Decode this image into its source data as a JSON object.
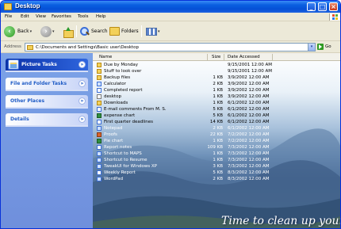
{
  "window": {
    "title": "Desktop"
  },
  "menu": [
    "File",
    "Edit",
    "View",
    "Favorites",
    "Tools",
    "Help"
  ],
  "toolbar": {
    "back_label": "Back",
    "search_label": "Search",
    "folders_label": "Folders"
  },
  "address": {
    "label": "Address",
    "value": "C:\\Documents and Settings\\Basic user\\Desktop",
    "go_label": "Go"
  },
  "task_panels": [
    {
      "title": "Picture Tasks"
    },
    {
      "title": "File and Folder Tasks"
    },
    {
      "title": "Other Places"
    },
    {
      "title": "Details"
    }
  ],
  "columns": {
    "name": "Name",
    "size": "Size",
    "date": "Date Accessed"
  },
  "files": [
    {
      "name": "Due by Monday",
      "size": "",
      "date": "9/15/2001 12:00 AM",
      "icon": "folder-icon"
    },
    {
      "name": "Stuff to look over",
      "size": "",
      "date": "9/15/2001 12:00 AM",
      "icon": "folder-icon"
    },
    {
      "name": "Backup files",
      "size": "1 KB",
      "date": "3/9/2002 12:00 AM",
      "icon": "folder-icon"
    },
    {
      "name": "Calculator",
      "size": "2 KB",
      "date": "3/9/2002 12:00 AM",
      "icon": "shortcut-icon"
    },
    {
      "name": "Completed report",
      "size": "1 KB",
      "date": "3/9/2002 12:00 AM",
      "icon": "document-icon"
    },
    {
      "name": "desktop",
      "size": "1 KB",
      "date": "3/9/2002 12:00 AM",
      "icon": "text-file-icon"
    },
    {
      "name": "Downloads",
      "size": "1 KB",
      "date": "6/1/2002 12:00 AM",
      "icon": "folder-icon"
    },
    {
      "name": "E-mail comments From M. S.",
      "size": "5 KB",
      "date": "6/1/2002 12:00 AM",
      "icon": "document-icon"
    },
    {
      "name": "expense chart",
      "size": "5 KB",
      "date": "6/1/2002 12:00 AM",
      "icon": "spreadsheet-icon"
    },
    {
      "name": "First quarter deadlines",
      "size": "14 KB",
      "date": "6/1/2002 12:00 AM",
      "icon": "document-icon"
    },
    {
      "name": "Notepad",
      "size": "2 KB",
      "date": "6/1/2002 12:00 AM",
      "icon": "shortcut-icon"
    },
    {
      "name": "Proofs",
      "size": "22 KB",
      "date": "7/2/2002 12:00 AM",
      "icon": "presentation-icon"
    },
    {
      "name": "Pie chart",
      "size": "1 KB",
      "date": "7/2/2002 12:00 AM",
      "icon": "spreadsheet-icon"
    },
    {
      "name": "Report notes",
      "size": "109 KB",
      "date": "7/3/2002 12:00 AM",
      "icon": "document-icon"
    },
    {
      "name": "Shortcut to MAPS",
      "size": "1 KB",
      "date": "7/3/2002 12:00 AM",
      "icon": "shortcut-icon"
    },
    {
      "name": "Shortcut to Resume",
      "size": "1 KB",
      "date": "7/3/2002 12:00 AM",
      "icon": "shortcut-icon"
    },
    {
      "name": "TweakUI for Windows XP",
      "size": "3 KB",
      "date": "7/3/2002 12:00 AM",
      "icon": "shortcut-icon"
    },
    {
      "name": "Weekly Report",
      "size": "5 KB",
      "date": "8/3/2002 12:00 AM",
      "icon": "document-icon"
    },
    {
      "name": "WordPad",
      "size": "2 KB",
      "date": "8/3/2002 12:00 AM",
      "icon": "shortcut-icon"
    }
  ],
  "background_caption": "Time to clean up your desktop!"
}
